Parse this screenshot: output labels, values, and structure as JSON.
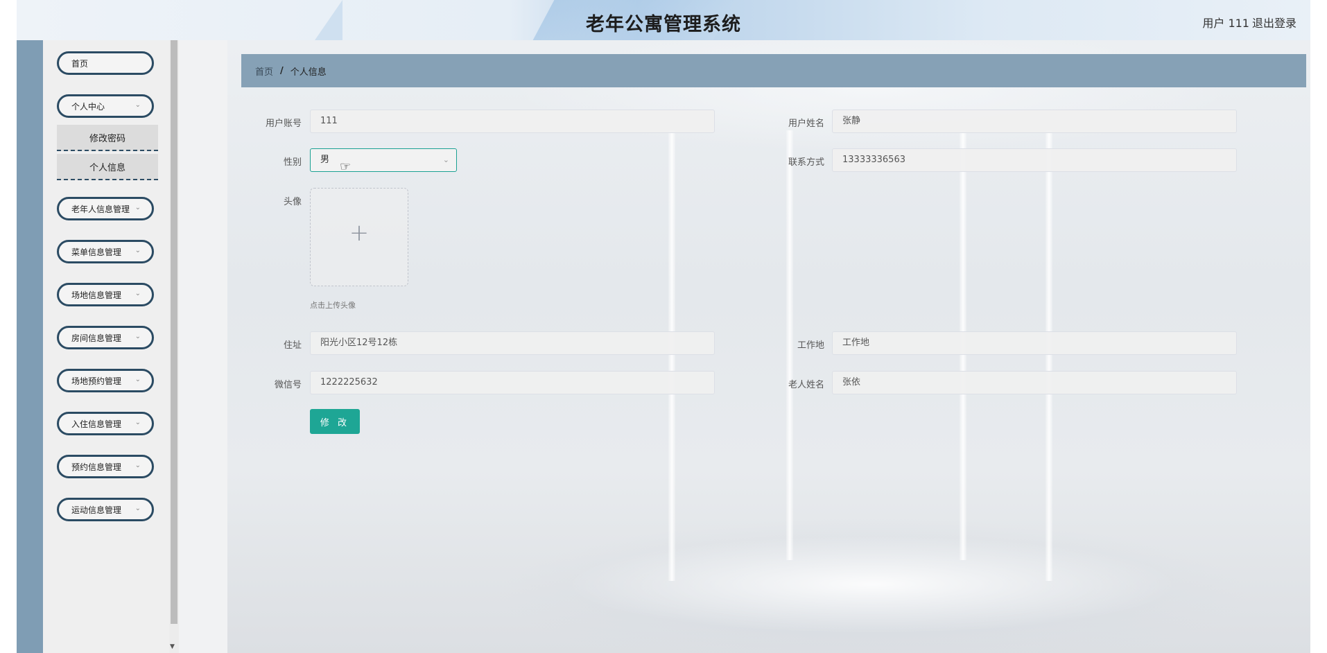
{
  "header": {
    "title": "老年公寓管理系统",
    "user_label": "用户 111",
    "logout_label": "退出登录"
  },
  "sidebar": {
    "home": "首页",
    "personal_center": "个人中心",
    "sub_change_password": "修改密码",
    "sub_personal_info": "个人信息",
    "items": [
      "老年人信息管理",
      "菜单信息管理",
      "场地信息管理",
      "房间信息管理",
      "场地预约管理",
      "入住信息管理",
      "预约信息管理",
      "运动信息管理"
    ]
  },
  "breadcrumb": {
    "home": "首页",
    "separator": "/",
    "current": "个人信息"
  },
  "form": {
    "account_label": "用户账号",
    "account_value": "111",
    "name_label": "用户姓名",
    "name_value": "张静",
    "gender_label": "性别",
    "gender_value": "男",
    "phone_label": "联系方式",
    "phone_value": "13333336563",
    "avatar_label": "头像",
    "avatar_tip": "点击上传头像",
    "address_label": "住址",
    "address_value": "阳光小区12号12栋",
    "workplace_label": "工作地",
    "workplace_value": "工作地",
    "wechat_label": "微信号",
    "wechat_value": "1222225632",
    "elder_name_label": "老人姓名",
    "elder_name_value": "张依",
    "submit_label": "修 改"
  },
  "colors": {
    "accent": "#1ea695",
    "menu_border": "#2b4b63",
    "breadcrumb_bg": "#86a1b6",
    "sidebar_band": "#7f9db4"
  }
}
